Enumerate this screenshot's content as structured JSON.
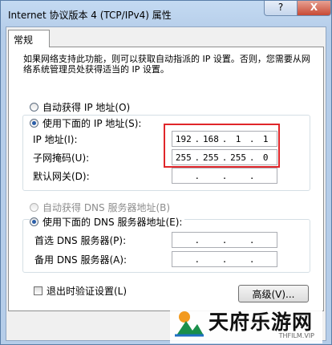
{
  "window": {
    "title": "Internet 协议版本 4 (TCP/IPv4) 属性",
    "help_label": "?",
    "close_label": "X"
  },
  "tab": {
    "label": "常规"
  },
  "intro": "如果网络支持此功能，则可以获取自动指派的 IP 设置。否则，您需要从网络系统管理员处获得适当的 IP 设置。",
  "ip_section": {
    "auto_label": "自动获得 IP 地址(O)",
    "manual_label": "使用下面的 IP 地址(S):",
    "ip_label": "IP 地址(I):",
    "ip_value": [
      "192",
      "168",
      "1",
      "1"
    ],
    "mask_label": "子网掩码(U):",
    "mask_value": [
      "255",
      "255",
      "255",
      "0"
    ],
    "gateway_label": "默认网关(D):",
    "gateway_value": [
      "",
      "",
      "",
      ""
    ]
  },
  "dns_section": {
    "auto_label": "自动获得 DNS 服务器地址(B)",
    "manual_label": "使用下面的 DNS 服务器地址(E):",
    "preferred_label": "首选 DNS 服务器(P):",
    "preferred_value": [
      "",
      "",
      "",
      ""
    ],
    "alternate_label": "备用 DNS 服务器(A):",
    "alternate_value": [
      "",
      "",
      "",
      ""
    ]
  },
  "validate_label": "退出时验证设置(L)",
  "advanced_label": "高级(V)...",
  "watermark": {
    "name": "天府乐游网",
    "site": "THFILM.VIP"
  },
  "colors": {
    "highlight": "#e0262a",
    "accent": "#2a5ea8"
  }
}
